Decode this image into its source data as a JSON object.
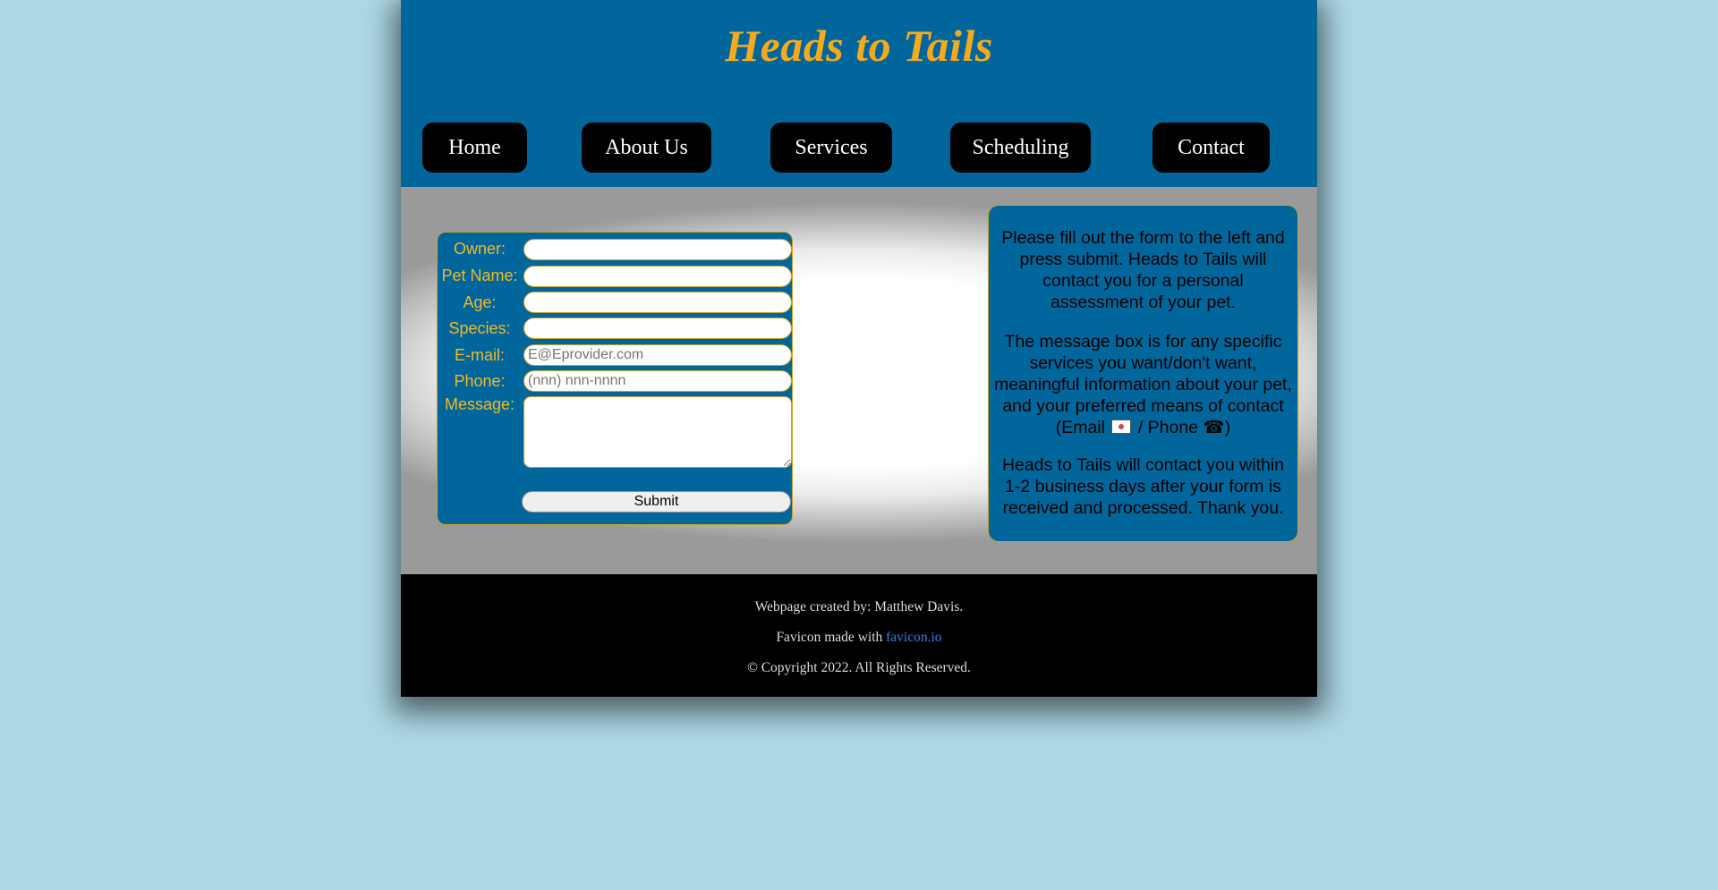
{
  "header": {
    "title": "Heads to Tails"
  },
  "nav": {
    "items": [
      {
        "label": "Home"
      },
      {
        "label": "About Us"
      },
      {
        "label": "Services"
      },
      {
        "label": "Scheduling"
      },
      {
        "label": "Contact"
      }
    ]
  },
  "form": {
    "owner_label": "Owner:",
    "pet_name_label": "Pet Name:",
    "age_label": "Age:",
    "species_label": "Species:",
    "email_label": "E-mail:",
    "email_placeholder": "E@Eprovider.com",
    "phone_label": "Phone:",
    "phone_placeholder": "(nnn) nnn-nnnn",
    "message_label": "Message:",
    "submit_label": "Submit"
  },
  "info": {
    "paragraph1": "Please fill out the form to the left and press submit. Heads to Tails will contact you for a personal assessment of your pet.",
    "paragraph2_text": "The message box is for any specific services you want/don't want, meaningful information about your pet, and your preferred means of contact (Email",
    "paragraph2_phone": "/ Phone ☎)",
    "paragraph3": "Heads to Tails will contact you within 1-2 business days after your form is received and processed. Thank you.",
    "email_icon": "envelope-icon"
  },
  "footer": {
    "created_by": "Webpage created by: Matthew Davis.",
    "favicon_prefix": "Favicon made with",
    "favicon_link": "favicon.io",
    "copyright": "© Copyright 2022. All Rights Reserved."
  },
  "colors": {
    "background": "#add8e6",
    "header_blue": "#00669c",
    "title_gold": "#f5a91c",
    "label_gold": "#f5b820",
    "nav_button": "#000000",
    "footer": "#000000",
    "link_blue": "#2f7fe8"
  }
}
